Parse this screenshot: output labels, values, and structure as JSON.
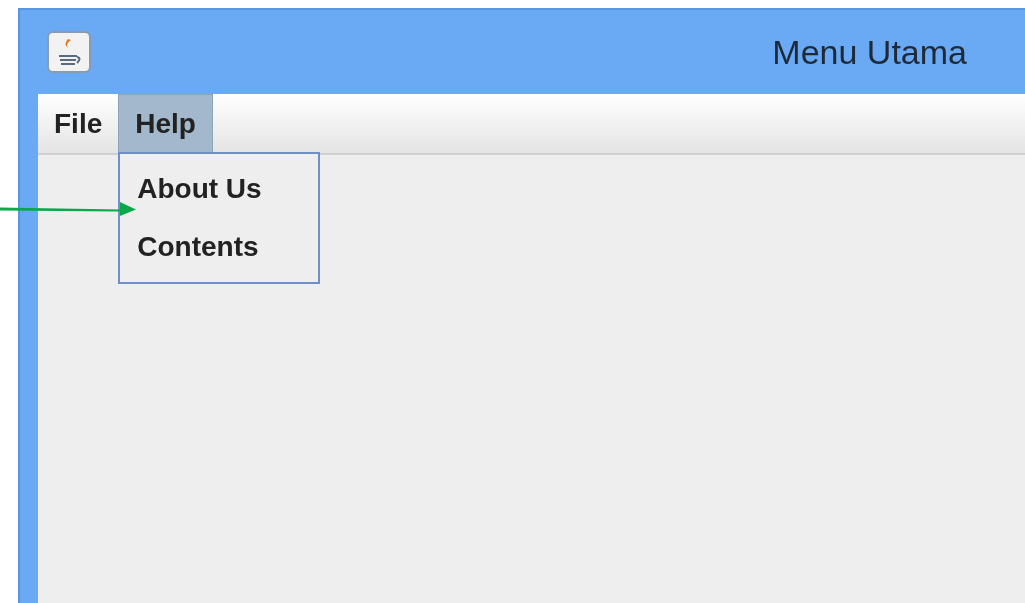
{
  "window": {
    "title": "Menu Utama"
  },
  "menu_bar": [
    {
      "label": "File",
      "selected": false
    },
    {
      "label": "Help",
      "selected": true,
      "items": [
        "About Us",
        "Contents"
      ]
    }
  ]
}
